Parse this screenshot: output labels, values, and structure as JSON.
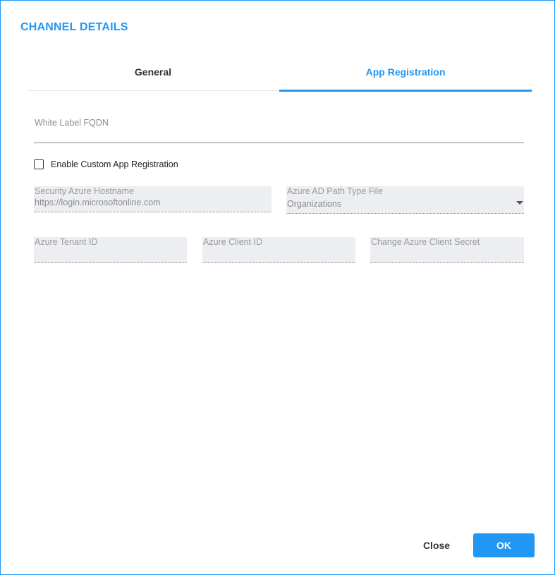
{
  "dialog": {
    "title": "CHANNEL DETAILS"
  },
  "tabs": [
    {
      "label": "General",
      "active": false
    },
    {
      "label": "App Registration",
      "active": true
    }
  ],
  "white_label_fqdn": {
    "label": "White Label FQDN",
    "value": ""
  },
  "custom_app_registration": {
    "label": "Enable Custom App Registration",
    "checked": false
  },
  "security_azure_hostname": {
    "label": "Security Azure Hostname",
    "value": "https://login.microsoftonline.com"
  },
  "azure_ad_path_type": {
    "label": "Azure AD Path Type File",
    "value": "Organizations"
  },
  "azure_tenant_id": {
    "label": "Azure Tenant ID",
    "value": ""
  },
  "azure_client_id": {
    "label": "Azure Client ID",
    "value": ""
  },
  "azure_client_secret": {
    "label": "Change Azure Client Secret",
    "value": ""
  },
  "footer": {
    "close_label": "Close",
    "ok_label": "OK"
  },
  "colors": {
    "accent": "#2196f3",
    "disabled_field_bg": "#eceef1",
    "text": "#333333"
  },
  "icons": {
    "dropdown": "caret-down-icon",
    "checkbox": "checkbox-unchecked-icon"
  }
}
